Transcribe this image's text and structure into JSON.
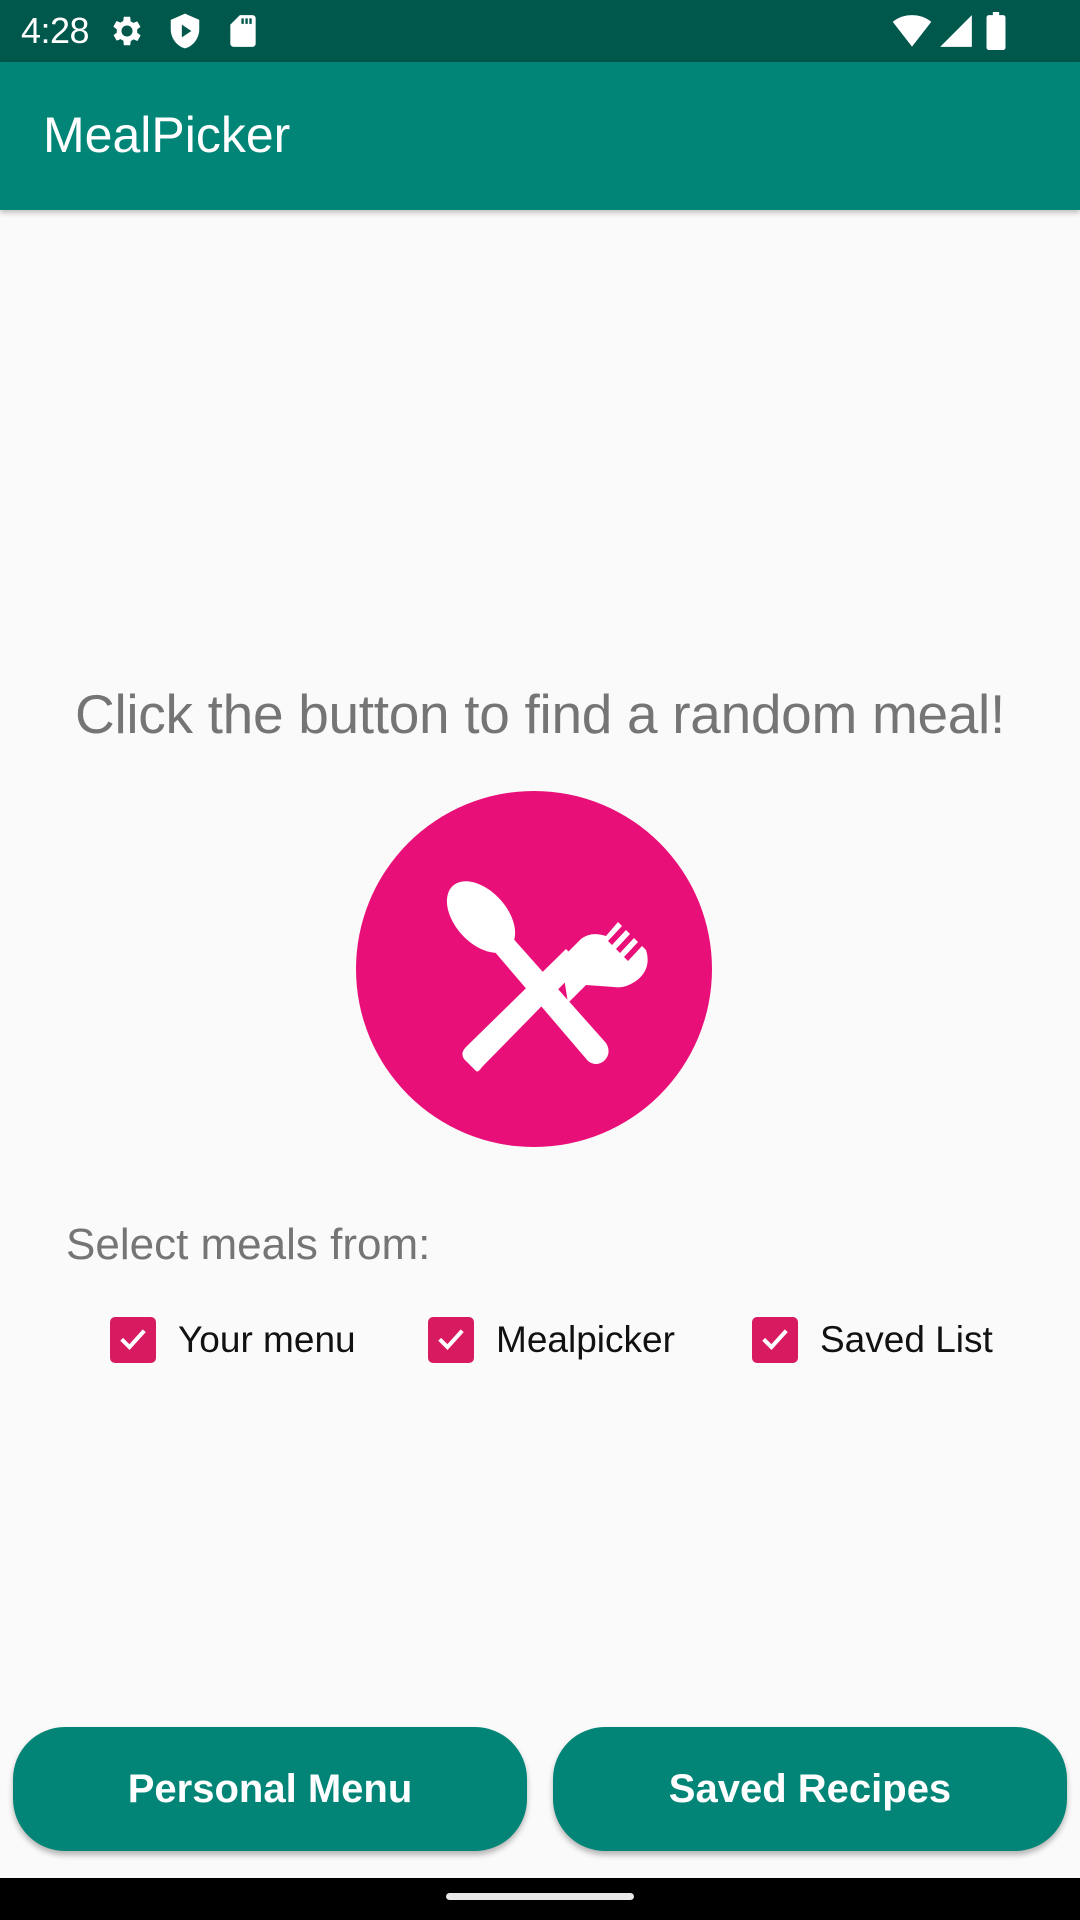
{
  "status_bar": {
    "time": "4:28",
    "left_icons": [
      "gear-icon",
      "shield-play-icon",
      "sd-card-icon"
    ],
    "right_icons": [
      "wifi-icon",
      "signal-icon",
      "battery-icon"
    ]
  },
  "app_bar": {
    "title": "MealPicker"
  },
  "main": {
    "headline": "Click the button to find a random meal!",
    "random_meal_button": {
      "icon": "spoon-fork-icon",
      "color": "#e90f78"
    },
    "select_label": "Select meals from:",
    "sources": [
      {
        "label": "Your menu",
        "checked": true
      },
      {
        "label": "Mealpicker",
        "checked": true
      },
      {
        "label": "Saved List",
        "checked": true
      }
    ]
  },
  "buttons": {
    "personal_menu": "Personal Menu",
    "saved_recipes": "Saved Recipes"
  },
  "colors": {
    "primary": "#018577",
    "primary_dark": "#00574b",
    "accent": "#d81b60",
    "meal_button": "#e90f78"
  }
}
